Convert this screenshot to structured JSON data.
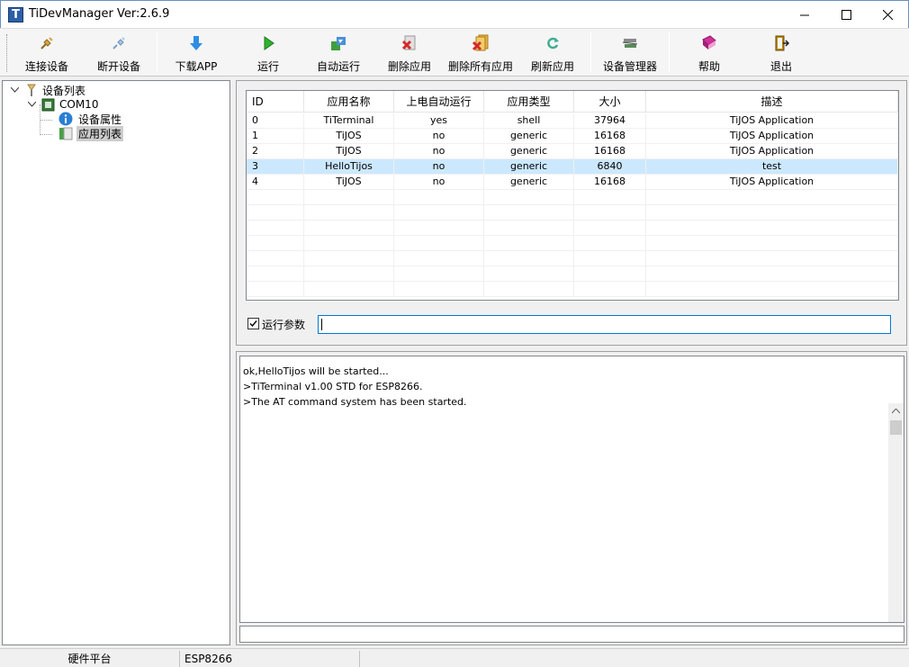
{
  "window": {
    "title": "TiDevManager  Ver:2.6.9",
    "app_icon_letter": "T"
  },
  "toolbar": {
    "buttons": [
      {
        "label": "连接设备",
        "icon": "connect-icon"
      },
      {
        "label": "断开设备",
        "icon": "disconnect-icon"
      },
      {
        "label": "下载APP",
        "icon": "download-icon"
      },
      {
        "label": "运行",
        "icon": "run-icon"
      },
      {
        "label": "自动运行",
        "icon": "autorun-icon"
      },
      {
        "label": "删除应用",
        "icon": "delete-app-icon"
      },
      {
        "label": "删除所有应用",
        "icon": "delete-all-icon"
      },
      {
        "label": "刷新应用",
        "icon": "refresh-icon"
      },
      {
        "label": "设备管理器",
        "icon": "device-manager-icon"
      },
      {
        "label": "帮助",
        "icon": "help-icon"
      },
      {
        "label": "退出",
        "icon": "exit-icon"
      }
    ]
  },
  "tree": {
    "root": "设备列表",
    "device": "COM10",
    "children": [
      "设备属性",
      "应用列表"
    ],
    "selected": "应用列表"
  },
  "app_list": {
    "columns": [
      "ID",
      "应用名称",
      "上电自动运行",
      "应用类型",
      "大小",
      "描述"
    ],
    "rows": [
      [
        "0",
        "TiTerminal",
        "yes",
        "shell",
        "37964",
        "TiJOS Application"
      ],
      [
        "1",
        "TiJOS",
        "no",
        "generic",
        "16168",
        "TiJOS Application"
      ],
      [
        "2",
        "TiJOS",
        "no",
        "generic",
        "16168",
        "TiJOS Application"
      ],
      [
        "3",
        "HelloTijos",
        "no",
        "generic",
        "6840",
        "test"
      ],
      [
        "4",
        "TiJOS",
        "no",
        "generic",
        "16168",
        "TiJOS Application"
      ]
    ],
    "selected_row": 3
  },
  "run_params": {
    "label": "运行参数",
    "checked": true,
    "value": ""
  },
  "console": {
    "lines": [
      "ok,HelloTijos will be started...",
      ">TiTerminal v1.00 STD for ESP8266.",
      ">The AT command system has been started."
    ]
  },
  "status": {
    "platform_label": "硬件平台",
    "platform_value": "ESP8266"
  },
  "colors": {
    "selection": "#cce8ff",
    "tree_selection": "#cdcdcd",
    "input_focus": "#0078d7"
  }
}
